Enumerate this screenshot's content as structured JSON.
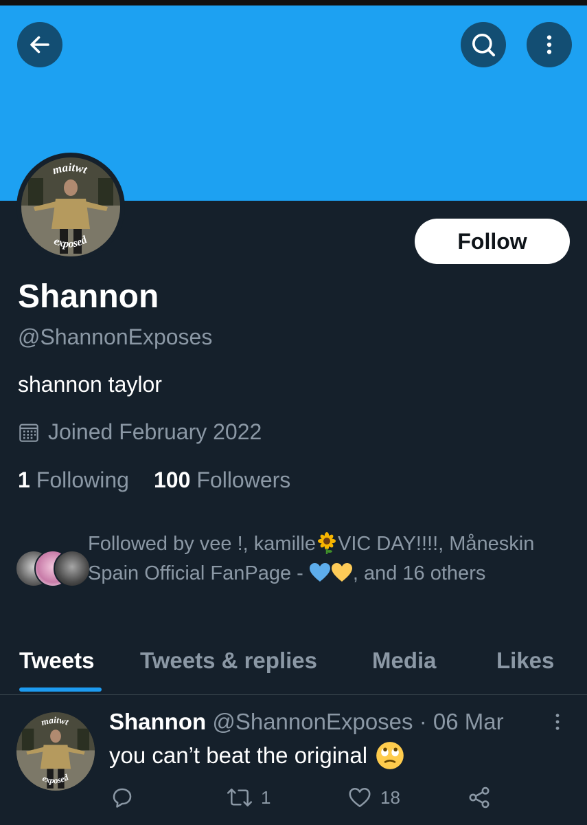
{
  "header": {
    "back_icon": "back-arrow-icon",
    "search_icon": "search-icon",
    "more_icon": "more-vertical-icon",
    "banner_color": "#1da1f2"
  },
  "profile": {
    "avatar_text_top": "maitwt",
    "avatar_text_bottom": "exposed",
    "follow_label": "Follow",
    "name": "Shannon",
    "handle": "@ShannonExposes",
    "bio": "shannon taylor",
    "joined": "Joined February 2022",
    "following_count": "1",
    "following_label": "Following",
    "followers_count": "100",
    "followers_label": "Followers"
  },
  "followed_by": {
    "prefix": "Followed by vee !, kamille",
    "part2": "VIC DAY!!!!, Måneskin Spain Official FanPage - ",
    "suffix": ", and 16 others"
  },
  "tabs": [
    "Tweets",
    "Tweets & replies",
    "Media",
    "Likes"
  ],
  "tweet": {
    "name": "Shannon",
    "meta": "@ShannonExposes · 06 Mar",
    "text": "you can’t beat the original",
    "reply_icon": "reply-icon",
    "retweet_count": "1",
    "like_count": "18",
    "share_icon": "share-icon"
  },
  "colors": {
    "background": "#15202b",
    "accent": "#1d9bf0",
    "secondary_text": "#8b98a5"
  }
}
